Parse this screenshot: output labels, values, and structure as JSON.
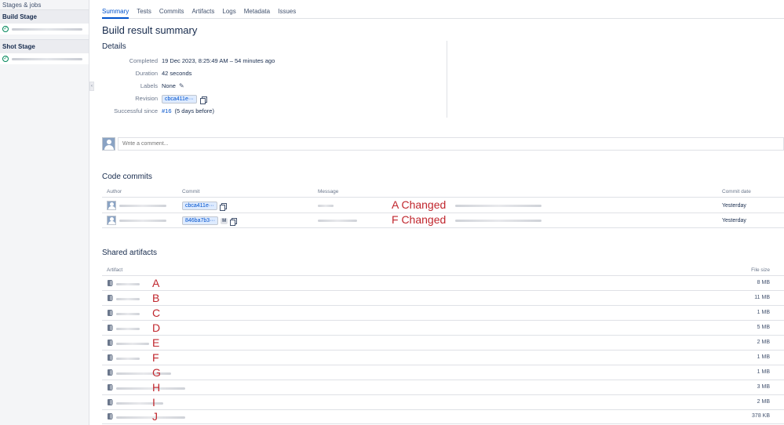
{
  "sidebar": {
    "title": "Stages & jobs",
    "stages": [
      {
        "name": "Build Stage"
      },
      {
        "name": "Shot Stage"
      }
    ]
  },
  "tabs": [
    "Summary",
    "Tests",
    "Commits",
    "Artifacts",
    "Logs",
    "Metadata",
    "Issues"
  ],
  "page_title": "Build result summary",
  "details": {
    "title": "Details",
    "completed_label": "Completed",
    "completed_value": "19 Dec 2023, 8:25:49 AM – 54 minutes ago",
    "duration_label": "Duration",
    "duration_value": "42 seconds",
    "labels_label": "Labels",
    "labels_value": "None",
    "revision_label": "Revision",
    "revision_value": "cbca411e···",
    "successful_label": "Successful since",
    "successful_link": "#16",
    "successful_rest": "(5 days before)"
  },
  "comment": {
    "placeholder": "Write a comment..."
  },
  "commits": {
    "title": "Code commits",
    "headers": {
      "author": "Author",
      "commit": "Commit",
      "message": "Message",
      "date": "Commit date"
    },
    "rows": [
      {
        "hash": "cbca411e···",
        "annotation": "A Changed",
        "date": "Yesterday",
        "merge": ""
      },
      {
        "hash": "846ba7b3···",
        "annotation": "F Changed",
        "date": "Yesterday",
        "merge": "M"
      }
    ]
  },
  "artifacts": {
    "title": "Shared artifacts",
    "headers": {
      "artifact": "Artifact",
      "size": "File size"
    },
    "rows": [
      {
        "annotation": "A",
        "size": "8 MB"
      },
      {
        "annotation": "B",
        "size": "11 MB"
      },
      {
        "annotation": "C",
        "size": "1 MB"
      },
      {
        "annotation": "D",
        "size": "5 MB"
      },
      {
        "annotation": "E",
        "size": "2 MB"
      },
      {
        "annotation": "F",
        "size": "1 MB"
      },
      {
        "annotation": "G",
        "size": "1 MB"
      },
      {
        "annotation": "H",
        "size": "3 MB"
      },
      {
        "annotation": "I",
        "size": "2 MB"
      },
      {
        "annotation": "J",
        "size": "378 KB"
      }
    ]
  },
  "icons": {
    "stage_status": "check-circle-icon",
    "copy": "copy-icon",
    "edit": "pencil-icon",
    "artifact": "file-icon",
    "avatar": "user-avatar-icon"
  },
  "colors": {
    "link": "#0052cc",
    "success": "#00875a",
    "annotation": "#c0262d"
  }
}
